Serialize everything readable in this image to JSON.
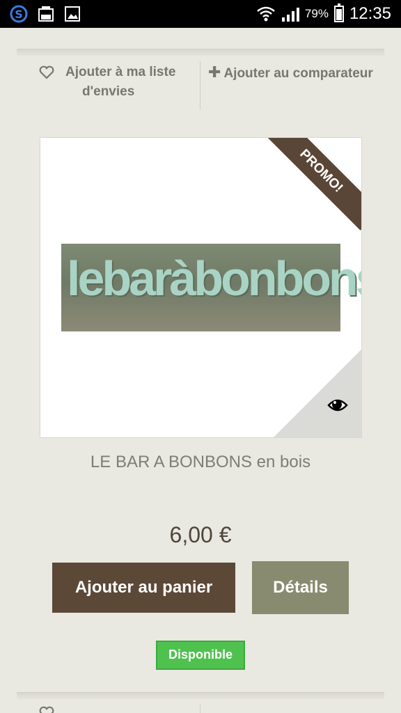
{
  "status_bar": {
    "battery_percent": "79%",
    "time": "12:35",
    "icons": [
      "skype-icon",
      "gallery-icon",
      "image-icon",
      "wifi-icon",
      "signal-icon",
      "battery-icon"
    ]
  },
  "actions": {
    "wishlist_line1": "Ajouter à ma liste",
    "wishlist_line2": "d'envies",
    "compare": "Ajouter au comparateur"
  },
  "product": {
    "image_text": "lebaràbonbons",
    "ribbon": "PROMO!",
    "name": "LE BAR A BONBONS en bois",
    "price": "6,00 €",
    "add_to_cart": "Ajouter au panier",
    "details": "Détails",
    "availability": "Disponible"
  },
  "colors": {
    "background": "#e9e8e1",
    "ribbon": "#5a4637",
    "cart_button": "#5c4837",
    "details_button": "#888b6f",
    "available_badge": "#4fc14f"
  }
}
